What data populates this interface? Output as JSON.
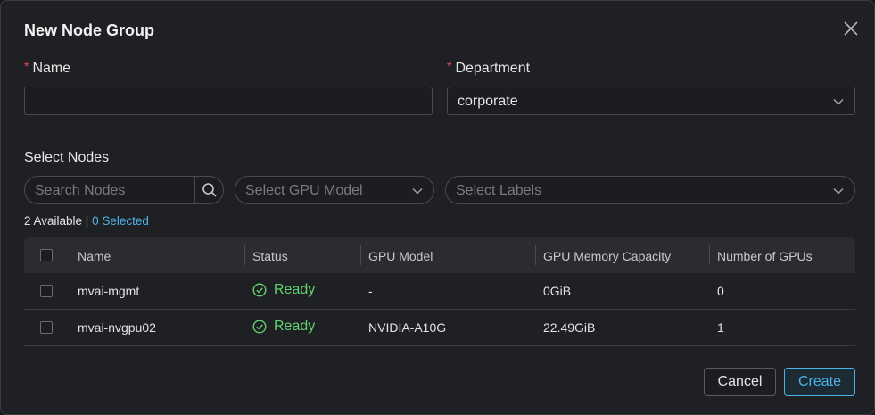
{
  "dialog": {
    "title": "New Node Group",
    "close_icon": "close-icon"
  },
  "form": {
    "name_label": "Name",
    "name_value": "",
    "department_label": "Department",
    "department_value": "corporate",
    "required_marker": "*"
  },
  "nodes": {
    "section_label": "Select Nodes",
    "search_placeholder": "Search Nodes",
    "gpu_model_placeholder": "Select GPU Model",
    "labels_placeholder": "Select Labels",
    "available_text": "2 Available |",
    "selected_text": "0 Selected"
  },
  "table": {
    "headers": [
      "Name",
      "Status",
      "GPU Model",
      "GPU Memory Capacity",
      "Number of GPUs"
    ],
    "rows": [
      {
        "name": "mvai-mgmt",
        "status": "Ready",
        "gpu_model": "-",
        "memory": "0GiB",
        "gpus": "0"
      },
      {
        "name": "mvai-nvgpu02",
        "status": "Ready",
        "gpu_model": "NVIDIA-A10G",
        "memory": "22.49GiB",
        "gpus": "1"
      }
    ]
  },
  "actions": {
    "cancel_label": "Cancel",
    "create_label": "Create"
  },
  "colors": {
    "accent": "#4db3e6",
    "ready": "#62d26f",
    "required": "#e5484d"
  }
}
